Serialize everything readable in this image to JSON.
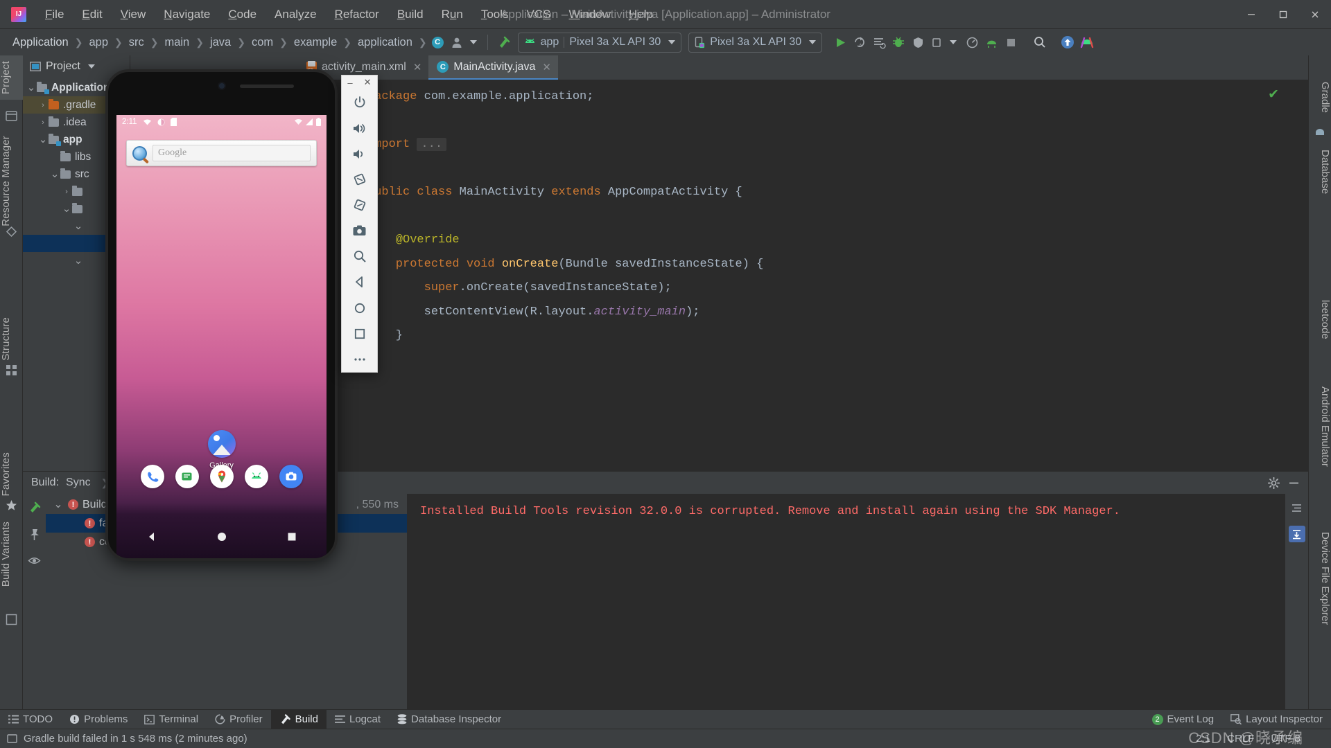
{
  "window": {
    "title": "Application – MainActivity.java [Application.app] – Administrator",
    "minimize": "–",
    "maximize": "▢",
    "close": "✕"
  },
  "menu": [
    {
      "label": "File",
      "mnemonic": "F"
    },
    {
      "label": "Edit",
      "mnemonic": "E"
    },
    {
      "label": "View",
      "mnemonic": "V"
    },
    {
      "label": "Navigate",
      "mnemonic": "N"
    },
    {
      "label": "Code",
      "mnemonic": "C"
    },
    {
      "label": "Analyze",
      "mnemonic": "y"
    },
    {
      "label": "Refactor",
      "mnemonic": "R"
    },
    {
      "label": "Build",
      "mnemonic": "B"
    },
    {
      "label": "Run",
      "mnemonic": "u"
    },
    {
      "label": "Tools",
      "mnemonic": "T"
    },
    {
      "label": "VCS",
      "mnemonic": "S"
    },
    {
      "label": "Window",
      "mnemonic": "W"
    },
    {
      "label": "Help",
      "mnemonic": "H"
    }
  ],
  "navbar": {
    "breadcrumbs": [
      "Application",
      "app",
      "src",
      "main",
      "java",
      "com",
      "example",
      "application"
    ],
    "module_selector": "app",
    "module_divider": "|",
    "run_config": "Pixel 3a XL API 30",
    "device_selector": "Pixel 3a XL API 30"
  },
  "left_tabs": [
    {
      "label": "Project",
      "active": true
    },
    {
      "label": "Resource Manager",
      "active": false
    },
    {
      "label": "Structure",
      "active": false
    },
    {
      "label": "Favorites",
      "active": false
    },
    {
      "label": "Build Variants",
      "active": false
    }
  ],
  "right_tabs": [
    {
      "label": "Gradle"
    },
    {
      "label": "Database"
    },
    {
      "label": "leetcode"
    },
    {
      "label": "Android Emulator"
    },
    {
      "label": "Device File Explorer"
    }
  ],
  "project_panel": {
    "title": "Project",
    "tree": [
      {
        "label": "Application",
        "indent": 0,
        "arrow": "v",
        "icon": "module-folder",
        "bold": true,
        "state": "normal"
      },
      {
        "label": ".gradle",
        "indent": 1,
        "arrow": ">",
        "icon": "orange-folder",
        "bold": false,
        "state": "selected"
      },
      {
        "label": ".idea",
        "indent": 1,
        "arrow": ">",
        "icon": "folder",
        "bold": false,
        "state": "normal"
      },
      {
        "label": "app",
        "indent": 1,
        "arrow": "v",
        "icon": "module-folder",
        "bold": true,
        "state": "normal"
      },
      {
        "label": "libs",
        "indent": 2,
        "arrow": "",
        "icon": "folder",
        "bold": false,
        "state": "normal"
      },
      {
        "label": "src",
        "indent": 2,
        "arrow": "v",
        "icon": "folder",
        "bold": false,
        "state": "normal"
      },
      {
        "label": "",
        "indent": 3,
        "arrow": ">",
        "icon": "folder",
        "bold": false,
        "state": "normal"
      },
      {
        "label": "",
        "indent": 3,
        "arrow": "v",
        "icon": "folder",
        "bold": false,
        "state": "normal"
      },
      {
        "label": "",
        "indent": 4,
        "arrow": "v",
        "icon": "",
        "bold": false,
        "state": "normal"
      },
      {
        "label": "",
        "indent": 4,
        "arrow": "",
        "icon": "",
        "bold": false,
        "state": "highlighted"
      },
      {
        "label": "",
        "indent": 4,
        "arrow": "v",
        "icon": "",
        "bold": false,
        "state": "normal"
      }
    ]
  },
  "editor": {
    "tabs": [
      {
        "label": "activity_main.xml",
        "icon": "xml-layout-icon",
        "active": false,
        "close": "✕"
      },
      {
        "label": "MainActivity.java",
        "icon": "java-class-icon",
        "active": true,
        "close": "✕"
      }
    ],
    "lines": [
      {
        "segments": [
          {
            "t": "package ",
            "c": "kw"
          },
          {
            "t": "com.example.application;",
            "c": "plain"
          }
        ]
      },
      {
        "segments": []
      },
      {
        "segments": [
          {
            "t": "import ",
            "c": "kw"
          },
          {
            "t": "...",
            "c": "fold"
          }
        ]
      },
      {
        "segments": []
      },
      {
        "segments": [
          {
            "t": "public ",
            "c": "kw"
          },
          {
            "t": "class ",
            "c": "kw"
          },
          {
            "t": "MainActivity ",
            "c": "plain"
          },
          {
            "t": "extends ",
            "c": "kw"
          },
          {
            "t": "AppCompatActivity {",
            "c": "plain"
          }
        ]
      },
      {
        "segments": []
      },
      {
        "segments": [
          {
            "t": "    @Override",
            "c": "ann"
          }
        ]
      },
      {
        "segments": [
          {
            "t": "    protected ",
            "c": "kw"
          },
          {
            "t": "void ",
            "c": "kw"
          },
          {
            "t": "onCreate",
            "c": "fn"
          },
          {
            "t": "(Bundle savedInstanceState) {",
            "c": "plain"
          }
        ]
      },
      {
        "segments": [
          {
            "t": "        super",
            "c": "kw"
          },
          {
            "t": ".onCreate(savedInstanceState);",
            "c": "plain"
          }
        ]
      },
      {
        "segments": [
          {
            "t": "        setContentView(R.layout.",
            "c": "plain"
          },
          {
            "t": "activity_main",
            "c": "field"
          },
          {
            "t": ");",
            "c": "plain"
          }
        ]
      },
      {
        "segments": [
          {
            "t": "    }",
            "c": "plain"
          }
        ]
      }
    ],
    "inspection_status": "✔"
  },
  "emulator": {
    "status_time": "2:11",
    "status_icons": [
      "wifi-no-internet-icon",
      "alarm-icon",
      "sd-card-icon"
    ],
    "status_icons_right": [
      "wifi-off-icon",
      "signal-icon",
      "battery-icon"
    ],
    "search_placeholder": "Google",
    "search_icon": "google-search-magnifier-icon",
    "apps": [
      {
        "label": "Gallery",
        "icon": "gallery-icon"
      }
    ],
    "dock": [
      {
        "name": "phone-icon"
      },
      {
        "name": "messages-icon"
      },
      {
        "name": "maps-icon"
      },
      {
        "name": "play-store-icon"
      },
      {
        "name": "camera-icon"
      }
    ],
    "navkeys": [
      "back-button",
      "home-button",
      "recents-button"
    ],
    "toolbar": {
      "minimize": "–",
      "close": "✕",
      "buttons": [
        "power-icon",
        "volume-up-icon",
        "volume-down-icon",
        "rotate-left-icon",
        "rotate-right-icon",
        "screenshot-icon",
        "zoom-icon",
        "back-icon",
        "home-icon",
        "overview-icon",
        "more-icon"
      ]
    }
  },
  "build_panel": {
    "title": "Build:",
    "breadcrumb": "Sync",
    "tree": [
      {
        "label": "Build",
        "icon": "error-icon",
        "arrow": "v",
        "indent": 0,
        "selected": false,
        "time": ""
      },
      {
        "label": "failed",
        "icon": "error-icon",
        "arrow": "",
        "indent": 1,
        "selected": true,
        "time": ""
      },
      {
        "label": "corrupted. Remove",
        "icon": "error-icon",
        "arrow": "",
        "indent": 1,
        "selected": false,
        "time": ""
      }
    ],
    "duration_label": ", 550 ms",
    "message": "Installed Build Tools revision 32.0.0 is corrupted. Remove and install again using the SDK Manager.",
    "gear_icon": "settings-icon",
    "minimize_icon": "minimize-icon",
    "side_buttons": [
      "expand-icon",
      "collapse-icon",
      "scroll-to-end-icon"
    ]
  },
  "bottom_windows": [
    {
      "label": "TODO",
      "icon": "todo-icon",
      "active": false
    },
    {
      "label": "Problems",
      "icon": "problems-icon",
      "active": false
    },
    {
      "label": "Terminal",
      "icon": "terminal-icon",
      "active": false
    },
    {
      "label": "Profiler",
      "icon": "profiler-icon",
      "active": false
    },
    {
      "label": "Build",
      "icon": "build-hammer-icon",
      "active": true
    },
    {
      "label": "Logcat",
      "icon": "logcat-icon",
      "active": false
    },
    {
      "label": "Database Inspector",
      "icon": "database-icon",
      "active": false
    }
  ],
  "bottom_windows_right": [
    {
      "label": "Event Log",
      "icon": "event-log-icon",
      "badge": "2"
    },
    {
      "label": "Layout Inspector",
      "icon": "layout-inspector-icon",
      "badge": ""
    }
  ],
  "statusbar": {
    "message": "Gradle build failed in 1 s 548 ms (2 minutes ago)",
    "caret": "2:1",
    "line_separator": "CRLF",
    "encoding": "UTF-8",
    "watermark": "CSDN @晓承编"
  },
  "colors": {
    "background": "#3c3f41",
    "editor_bg": "#2b2b2b",
    "accent_blue": "#4b6eaf",
    "error_red": "#ff6b68",
    "green": "#499c54",
    "selection": "#0d3158",
    "orange": "#c2601f"
  }
}
